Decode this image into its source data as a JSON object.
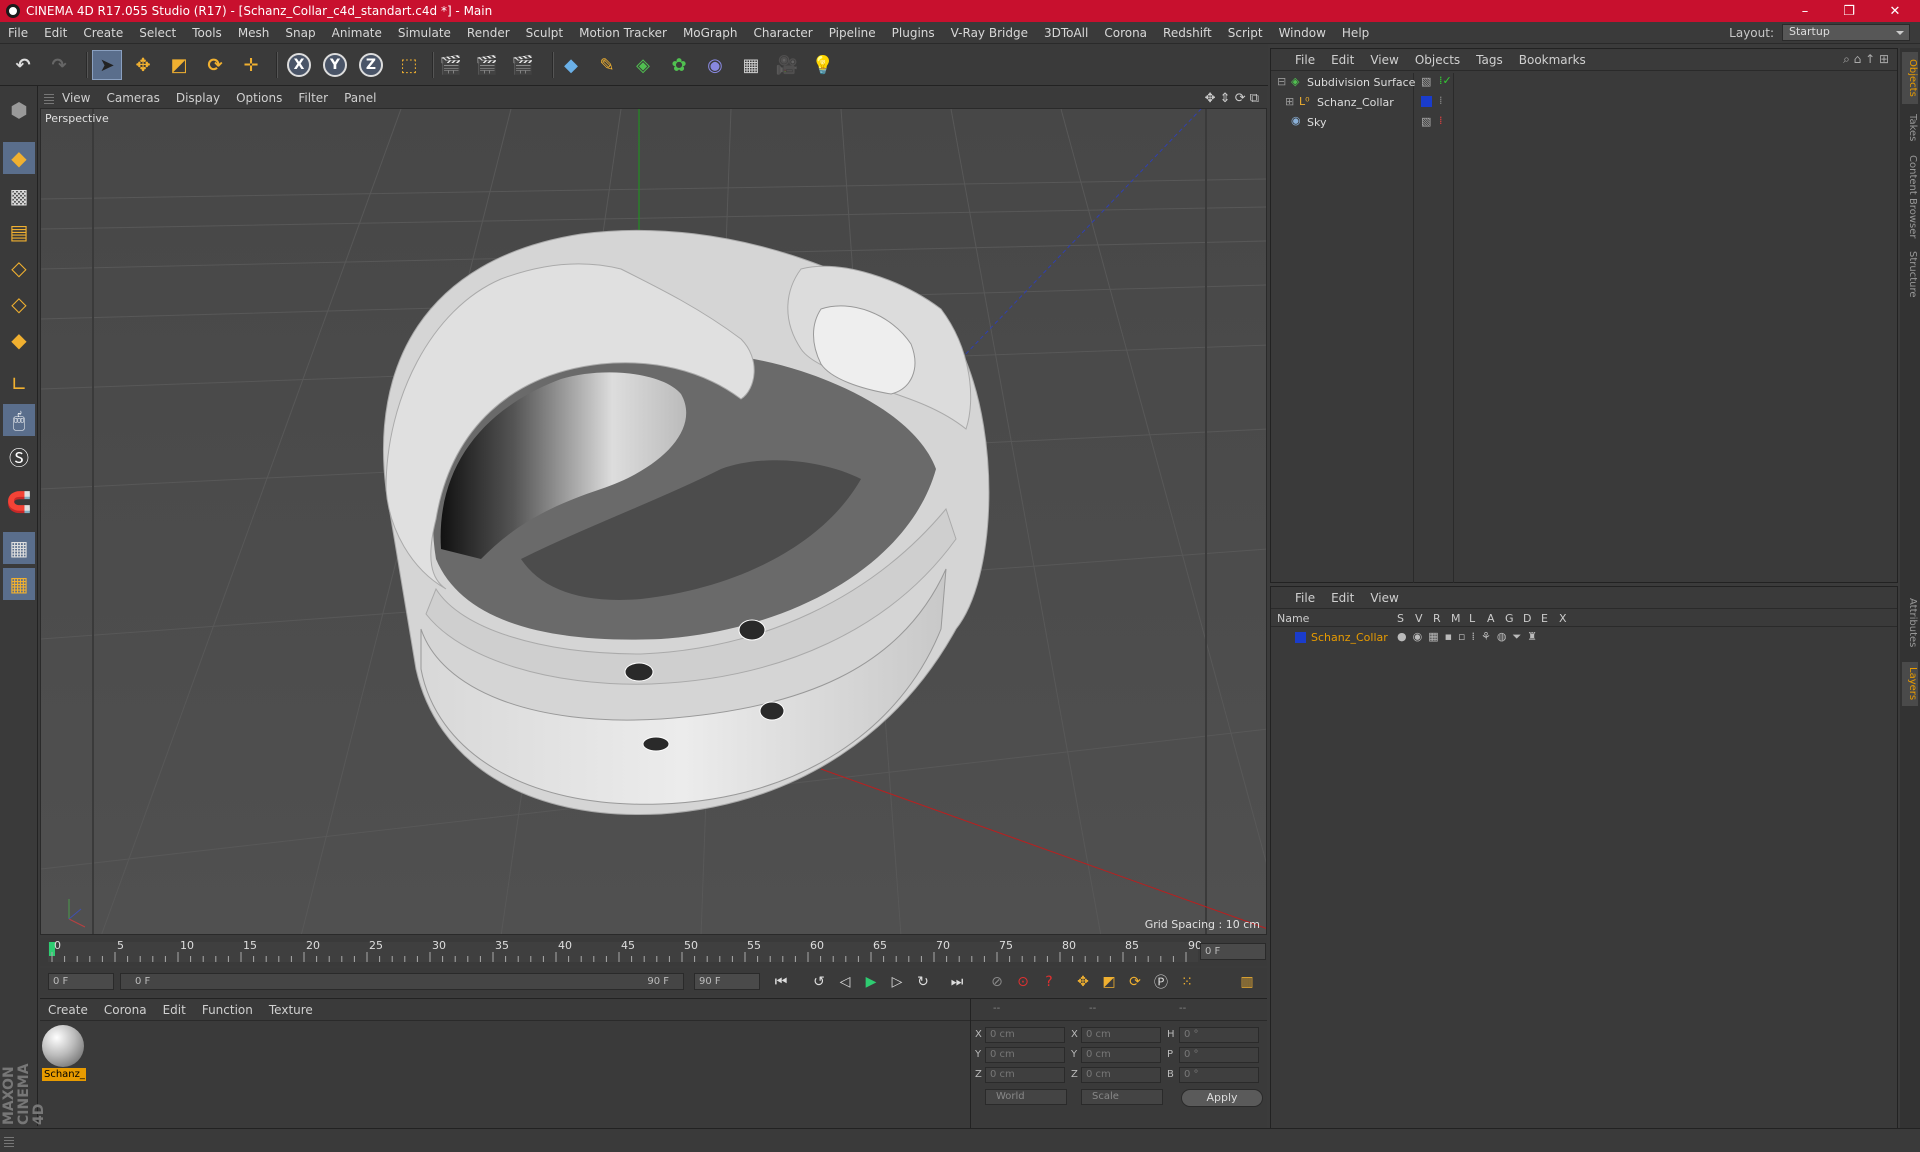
{
  "window": {
    "title": "CINEMA 4D R17.055 Studio (R17) - [Schanz_Collar_c4d_standart.c4d *] - Main",
    "controls": {
      "minimize": "–",
      "restore": "❐",
      "close": "✕"
    }
  },
  "menu": [
    "File",
    "Edit",
    "Create",
    "Select",
    "Tools",
    "Mesh",
    "Snap",
    "Animate",
    "Simulate",
    "Render",
    "Sculpt",
    "Motion Tracker",
    "MoGraph",
    "Character",
    "Pipeline",
    "Plugins",
    "V-Ray Bridge",
    "3DToAll",
    "Corona",
    "Redshift",
    "Script",
    "Window",
    "Help"
  ],
  "layout": {
    "label": "Layout:",
    "value": "Startup"
  },
  "toolbar": {
    "axis_x": "X",
    "axis_y": "Y",
    "axis_z": "Z"
  },
  "viewport": {
    "menu": [
      "View",
      "Cameras",
      "Display",
      "Options",
      "Filter",
      "Panel"
    ],
    "camera_label": "Perspective",
    "grid_spacing": "Grid Spacing : 10 cm"
  },
  "timeline": {
    "ticks": [
      "0",
      "5",
      "10",
      "15",
      "20",
      "25",
      "30",
      "35",
      "40",
      "45",
      "50",
      "55",
      "60",
      "65",
      "70",
      "75",
      "80",
      "85",
      "90"
    ],
    "current_frame": "0 F"
  },
  "transport": {
    "start_field": "0 F",
    "slider_start": "0 F",
    "slider_end": "90 F",
    "end_field": "90 F"
  },
  "material_panel": {
    "menu": [
      "Create",
      "Corona",
      "Edit",
      "Function",
      "Texture"
    ],
    "material_label": "Schanz_"
  },
  "coordinates": {
    "header": [
      "--",
      "--",
      "--"
    ],
    "rows": [
      {
        "l1": "X",
        "v1": "0 cm",
        "l2": "X",
        "v2": "0 cm",
        "l3": "H",
        "v3": "0 °"
      },
      {
        "l1": "Y",
        "v1": "0 cm",
        "l2": "Y",
        "v2": "0 cm",
        "l3": "P",
        "v3": "0 °"
      },
      {
        "l1": "Z",
        "v1": "0 cm",
        "l2": "Z",
        "v2": "0 cm",
        "l3": "B",
        "v3": "0 °"
      }
    ],
    "world": "World",
    "scale": "Scale",
    "apply": "Apply"
  },
  "object_manager": {
    "menu": [
      "File",
      "Edit",
      "View",
      "Objects",
      "Tags",
      "Bookmarks"
    ],
    "objects": [
      {
        "name": "Subdivision Surface",
        "icon": "subdivision-icon"
      },
      {
        "name": "Schanz_Collar",
        "icon": "null-object-icon"
      },
      {
        "name": "Sky",
        "icon": "sky-icon"
      }
    ]
  },
  "layer_manager": {
    "menu": [
      "File",
      "Edit",
      "View"
    ],
    "columns": [
      "Name",
      "S",
      "V",
      "R",
      "M",
      "L",
      "A",
      "G",
      "D",
      "E",
      "X"
    ],
    "layers": [
      {
        "name": "Schanz_Collar",
        "color": "#1a3ccc"
      }
    ]
  },
  "right_tabs": [
    "Objects",
    "Takes",
    "Content Browser",
    "Structure",
    "Attributes",
    "Layers"
  ],
  "branding": "MAXON CINEMA 4D",
  "colors": {
    "title_bar": "#c8102e",
    "accent": "#e89b00",
    "selected_tool": "#5a6e8c"
  }
}
